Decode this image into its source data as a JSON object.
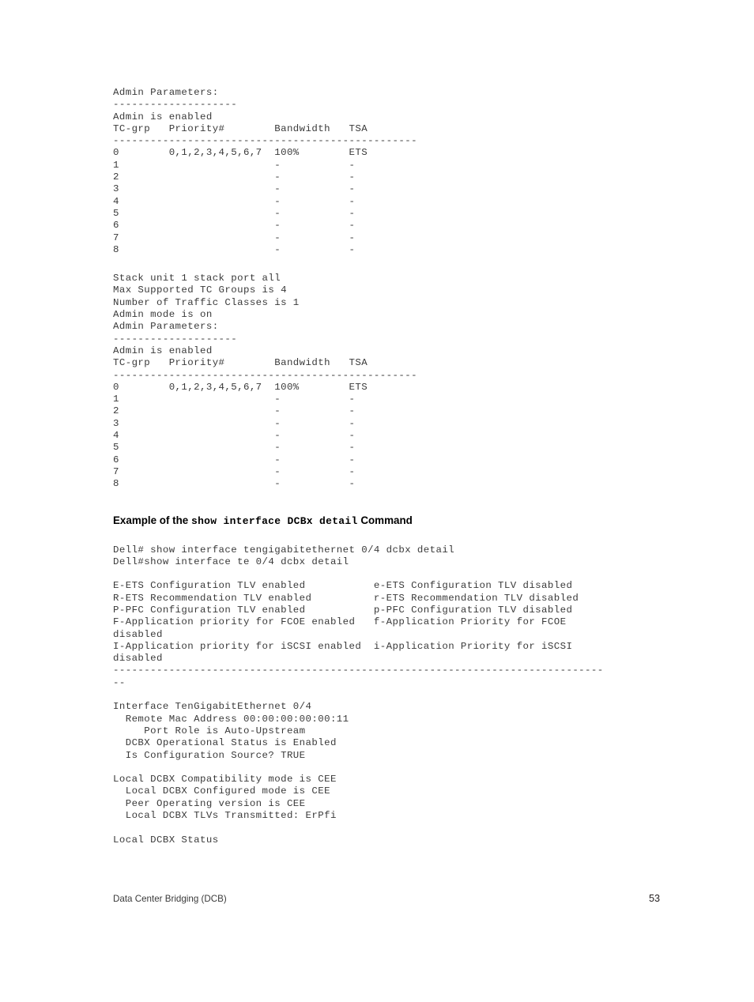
{
  "document": {
    "footer_title": "Data Center Bridging (DCB)",
    "page_number": "53"
  },
  "blocks": {
    "admin_params_1": "Admin Parameters:\n--------------------\nAdmin is enabled\nTC-grp   Priority#        Bandwidth   TSA\n-------------------------------------------------\n0        0,1,2,3,4,5,6,7  100%        ETS\n1                         -           -\n2                         -           -\n3                         -           -\n4                         -           -\n5                         -           -\n6                         -           -\n7                         -           -\n8                         -           -",
    "stack_unit_block": "Stack unit 1 stack port all\nMax Supported TC Groups is 4\nNumber of Traffic Classes is 1\nAdmin mode is on\nAdmin Parameters:\n--------------------\nAdmin is enabled\nTC-grp   Priority#        Bandwidth   TSA\n-------------------------------------------------\n0        0,1,2,3,4,5,6,7  100%        ETS\n1                         -           -\n2                         -           -\n3                         -           -\n4                         -           -\n5                         -           -\n6                         -           -\n7                         -           -\n8                         -           -",
    "command_lines": "Dell# show interface tengigabitethernet 0/4 dcbx detail\nDell#show interface te 0/4 dcbx detail",
    "tlv_block": "E-ETS Configuration TLV enabled           e-ETS Configuration TLV disabled\nR-ETS Recommendation TLV enabled          r-ETS Recommendation TLV disabled\nP-PFC Configuration TLV enabled           p-PFC Configuration TLV disabled\nF-Application priority for FCOE enabled   f-Application Priority for FCOE\ndisabled\nI-Application priority for iSCSI enabled  i-Application Priority for iSCSI\ndisabled\n-------------------------------------------------------------------------------\n--",
    "interface_block": "Interface TenGigabitEthernet 0/4\n  Remote Mac Address 00:00:00:00:00:11\n     Port Role is Auto-Upstream\n  DCBX Operational Status is Enabled\n  Is Configuration Source? TRUE",
    "local_dcbx_block": "Local DCBX Compatibility mode is CEE\n  Local DCBX Configured mode is CEE\n  Peer Operating version is CEE\n  Local DCBX TLVs Transmitted: ErPfi",
    "local_dcbx_status": "Local DCBX Status"
  },
  "heading": {
    "prefix": "Example of the ",
    "command": "show interface DCBx detail",
    "suffix": " Command"
  },
  "tables": {
    "columns": [
      "TC-grp",
      "Priority#",
      "Bandwidth",
      "TSA"
    ],
    "rows": [
      {
        "tc_grp": "0",
        "priority": "0,1,2,3,4,5,6,7",
        "bandwidth": "100%",
        "tsa": "ETS"
      },
      {
        "tc_grp": "1",
        "priority": "",
        "bandwidth": "-",
        "tsa": "-"
      },
      {
        "tc_grp": "2",
        "priority": "",
        "bandwidth": "-",
        "tsa": "-"
      },
      {
        "tc_grp": "3",
        "priority": "",
        "bandwidth": "-",
        "tsa": "-"
      },
      {
        "tc_grp": "4",
        "priority": "",
        "bandwidth": "-",
        "tsa": "-"
      },
      {
        "tc_grp": "5",
        "priority": "",
        "bandwidth": "-",
        "tsa": "-"
      },
      {
        "tc_grp": "6",
        "priority": "",
        "bandwidth": "-",
        "tsa": "-"
      },
      {
        "tc_grp": "7",
        "priority": "",
        "bandwidth": "-",
        "tsa": "-"
      },
      {
        "tc_grp": "8",
        "priority": "",
        "bandwidth": "-",
        "tsa": "-"
      }
    ]
  },
  "colors": {
    "page_background": "#ffffff",
    "console_text": "#3a3a3a",
    "heading_text": "#000000",
    "footer_text": "#3a3a3a"
  }
}
